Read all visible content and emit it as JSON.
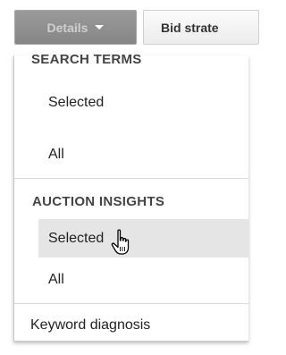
{
  "toolbar": {
    "details_label": "Details",
    "bid_strategy_label": "Bid strate"
  },
  "menu": {
    "search_terms": {
      "header": "SEARCH TERMS",
      "items": [
        "Selected",
        "All"
      ]
    },
    "auction_insights": {
      "header": "AUCTION INSIGHTS",
      "items": [
        "Selected",
        "All"
      ]
    },
    "keyword_diagnosis": "Keyword diagnosis"
  },
  "state": {
    "hovered_item": "auction-insights-selected"
  },
  "colors": {
    "details_button": "#8f8f8f",
    "hover_background": "#e5e5e5",
    "divider": "#dcdcdc"
  },
  "icons": {
    "caret": "caret-down-icon",
    "cursor": "hand-pointer-cursor-icon"
  }
}
